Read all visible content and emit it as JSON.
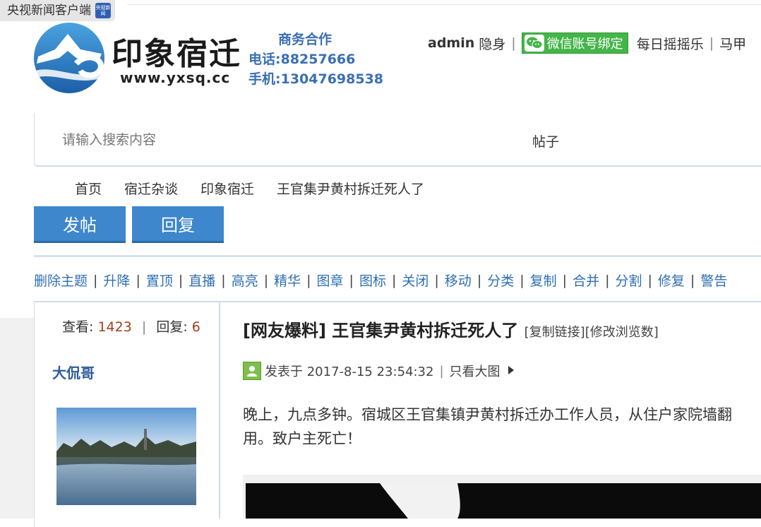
{
  "watermark": {
    "source": "央视新闻客户端",
    "badge": "央视新闻"
  },
  "site": {
    "logo_text": "印象宿迁",
    "logo_url": "www.yxsq.cc",
    "business": {
      "title": "商务合作",
      "phone": "电话:88257666",
      "mobile": "手机:13047698538"
    }
  },
  "user_bar": {
    "username": "admin",
    "invisible": "隐身",
    "wechat_bind": "微信账号绑定",
    "shake": "每日摇摇乐",
    "more": "马甲"
  },
  "search": {
    "placeholder": "请输入搜索内容",
    "type": "帖子"
  },
  "breadcrumb": [
    "首页",
    "宿迁杂谈",
    "印象宿迁",
    "王官集尹黄村拆迁死人了"
  ],
  "actions": {
    "post": "发帖",
    "reply": "回复"
  },
  "moderation": [
    "删除主题",
    "升降",
    "置顶",
    "直播",
    "高亮",
    "精华",
    "图章",
    "图标",
    "关闭",
    "移动",
    "分类",
    "复制",
    "合并",
    "分割",
    "修复",
    "警告"
  ],
  "stats": {
    "views_label": "查看:",
    "views": "1423",
    "replies_label": "回复:",
    "replies": "6"
  },
  "author": "大侃哥",
  "post": {
    "title": "[网友爆料] 王官集尹黄村拆迁死人了",
    "copy_link": "[复制链接]",
    "edit_views": "[修改浏览数]",
    "posted_at": "发表于 2017-8-15 23:54:32",
    "only_images": "只看大图",
    "body_line1": "晚上，九点多钟。宿城区王官集镇尹黄村拆迁办工作人员，从住户家院墙翻",
    "body_line2": "用。致户主死亡！"
  },
  "colors": {
    "accent": "#3e87cc",
    "link": "#2f6fb2",
    "wechat": "#44b549",
    "stat_number": "#a0401a"
  }
}
